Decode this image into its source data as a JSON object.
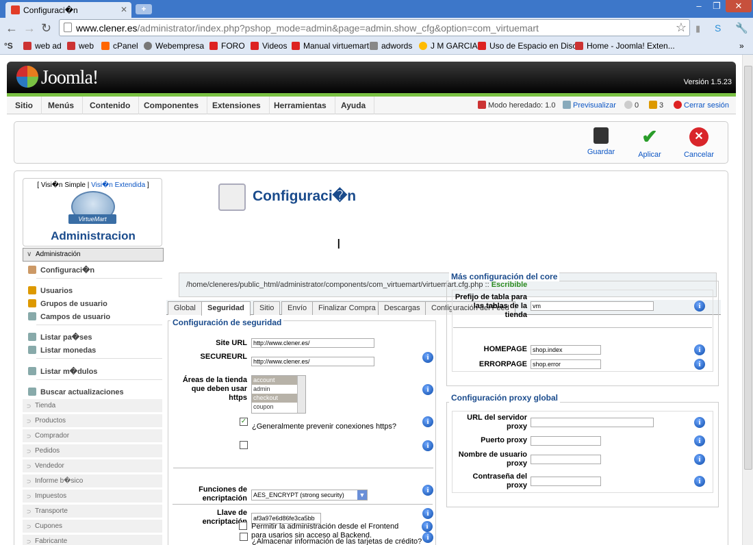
{
  "browser": {
    "tab_title": "Configuraci�n",
    "url_host": "www.clener.es",
    "url_path": "/administrator/index.php?pshop_mode=admin&page=admin.show_cfg&option=com_virtuemart",
    "bookmarks": [
      "web ad",
      "web",
      "cPanel",
      "Webempresa",
      "FORO",
      "Videos",
      "Manual virtuemart",
      "adwords",
      "J M GARCIA",
      "Uso de Espacio en Disco",
      "Home - Joomla! Exten..."
    ]
  },
  "joomla": {
    "logo": "Joomla!",
    "version": "Versión 1.5.23"
  },
  "menu": {
    "items": [
      "Sitio",
      "Menús",
      "Contenido",
      "Componentes",
      "Extensiones",
      "Herramientas",
      "Ayuda"
    ],
    "status": {
      "legacy": "Modo heredado: 1.0",
      "preview": "Previsualizar",
      "messages": "0",
      "users": "3",
      "logout": "Cerrar sesión"
    }
  },
  "toolbar": {
    "save": "Guardar",
    "apply": "Aplicar",
    "cancel": "Cancelar"
  },
  "sidebar": {
    "mode_simple": "Visi�n Simple",
    "mode_sep": "|",
    "mode_ext": "Visi�n Extendida",
    "logo_text": "VirtueMart",
    "title": "Administracion",
    "section": "Administración",
    "links": [
      "Configuraci�n",
      "Usuarios",
      "Grupos de usuario",
      "Campos de usuario",
      "Listar pa�ses",
      "Listar monedas",
      "Listar m�dulos",
      "Buscar actualizaciones"
    ],
    "categories": [
      "Tienda",
      "Productos",
      "Comprador",
      "Pedidos",
      "Vendedor",
      "Informe b�sico",
      "Impuestos",
      "Transporte",
      "Cupones",
      "Fabricante"
    ]
  },
  "page": {
    "title": "Configuraci�n",
    "path": "/home/cleneres/public_html/administrator/components/com_virtuemart/virtuemart.cfg.php ::",
    "writable": "Escribible"
  },
  "tabs": [
    "Global",
    "Seguridad",
    "Sitio",
    "Envío",
    "Finalizar Compra",
    "Descargas",
    "Configuración del Feed"
  ],
  "security": {
    "legend": "Configuración de seguridad",
    "site_url_label": "Site URL",
    "site_url": "http://www.clener.es/",
    "secure_url_label": "SECUREURL",
    "secure_url": "http://www.clener.es/",
    "https_areas_label": "Áreas de la tienda que deben usar https",
    "https_areas": [
      "account",
      "admin",
      "checkout",
      "coupon"
    ],
    "prevent_https": "¿Generalmente prevenir conexiones https?",
    "enc_func_label": "Funciones de encriptación",
    "enc_func": "AES_ENCRYPT (strong security)",
    "enc_key_label": "Llave de encriptación",
    "enc_key": "af3a97e6d86fe3ca5bb",
    "store_cc": "¿Almacenar información de las tarjetas de crédito?",
    "frontend_admin": "Permitir la administración desde el Frontend para usarios sin acceso al Backend."
  },
  "core": {
    "legend": "Más configuración del core",
    "prefix_label": "Prefijo de tabla para las tablas de la tienda",
    "prefix": "vm",
    "homepage_label": "HOMEPAGE",
    "homepage": "shop.index",
    "errorpage_label": "ERRORPAGE",
    "errorpage": "shop.error"
  },
  "proxy": {
    "legend": "Configuración proxy global",
    "url_label": "URL del servidor proxy",
    "port_label": "Puerto proxy",
    "user_label": "Nombre de usuario proxy",
    "pass_label": "Contraseña del proxy"
  },
  "colors": {
    "accent": "#1a4b8c",
    "link": "#0b55c4",
    "green": "#7ac143"
  }
}
